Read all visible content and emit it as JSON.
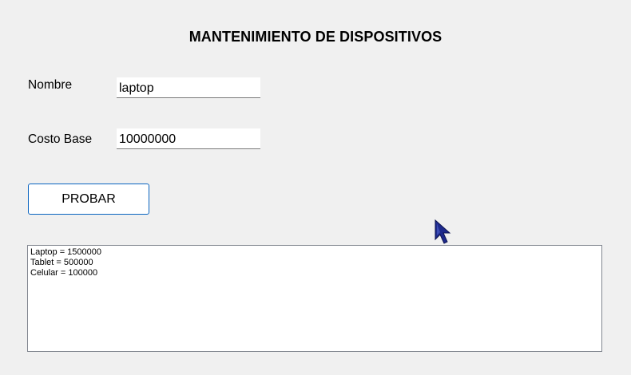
{
  "window": {
    "title": "MANTENIMIENTO DE DISPOSITIVOS"
  },
  "form": {
    "nombre_label": "Nombre",
    "nombre_value": "laptop",
    "costo_label": "Costo Base",
    "costo_value": "10000000",
    "probar_button": "PROBAR"
  },
  "output": {
    "lines": [
      "Laptop = 1500000",
      "Tablet = 500000",
      "Celular = 100000"
    ]
  },
  "colors": {
    "background": "#f0f0f0",
    "button_border": "#0a64c0",
    "cursor": "#1e2a8c"
  },
  "icons": {
    "cursor": "mouse-pointer-icon"
  }
}
